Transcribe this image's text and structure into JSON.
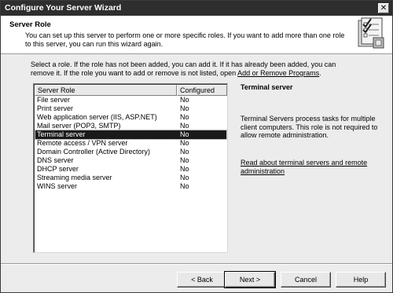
{
  "window": {
    "title": "Configure Your Server Wizard",
    "close_glyph": "✕"
  },
  "header": {
    "title": "Server Role",
    "description": "You can set up this server to perform one or more specific roles. If you want to add more than one role to this server, you can run this wizard again.",
    "icon": "wizard-checklist-icon"
  },
  "instructions": {
    "text": "Select a role. If the role has not been added, you can add it. If it has already been added, you can remove it. If the role you want to add or remove is not listed, open ",
    "link": "Add or Remove Programs",
    "suffix": "."
  },
  "roles_table": {
    "columns": [
      "Server Role",
      "Configured"
    ],
    "rows": [
      {
        "role": "File server",
        "configured": "No"
      },
      {
        "role": "Print server",
        "configured": "No"
      },
      {
        "role": "Web application server (IIS, ASP.NET)",
        "configured": "No"
      },
      {
        "role": "Mail server (POP3, SMTP)",
        "configured": "No"
      },
      {
        "role": "Terminal server",
        "configured": "No"
      },
      {
        "role": "Remote access / VPN server",
        "configured": "No"
      },
      {
        "role": "Domain Controller (Active Directory)",
        "configured": "No"
      },
      {
        "role": "DNS server",
        "configured": "No"
      },
      {
        "role": "DHCP server",
        "configured": "No"
      },
      {
        "role": "Streaming media server",
        "configured": "No"
      },
      {
        "role": "WINS server",
        "configured": "No"
      }
    ],
    "selected_index": 4
  },
  "details": {
    "title": "Terminal server",
    "description": "Terminal Servers process tasks for multiple client computers. This role is not required to allow remote administration.",
    "link": "Read about terminal servers and remote administration"
  },
  "buttons": {
    "back": "< Back",
    "next": "Next >",
    "cancel": "Cancel",
    "help": "Help"
  },
  "colors": {
    "selection": "#1a1a1a",
    "titlebar": "#2e2e2e",
    "dialog": "#ececec"
  }
}
